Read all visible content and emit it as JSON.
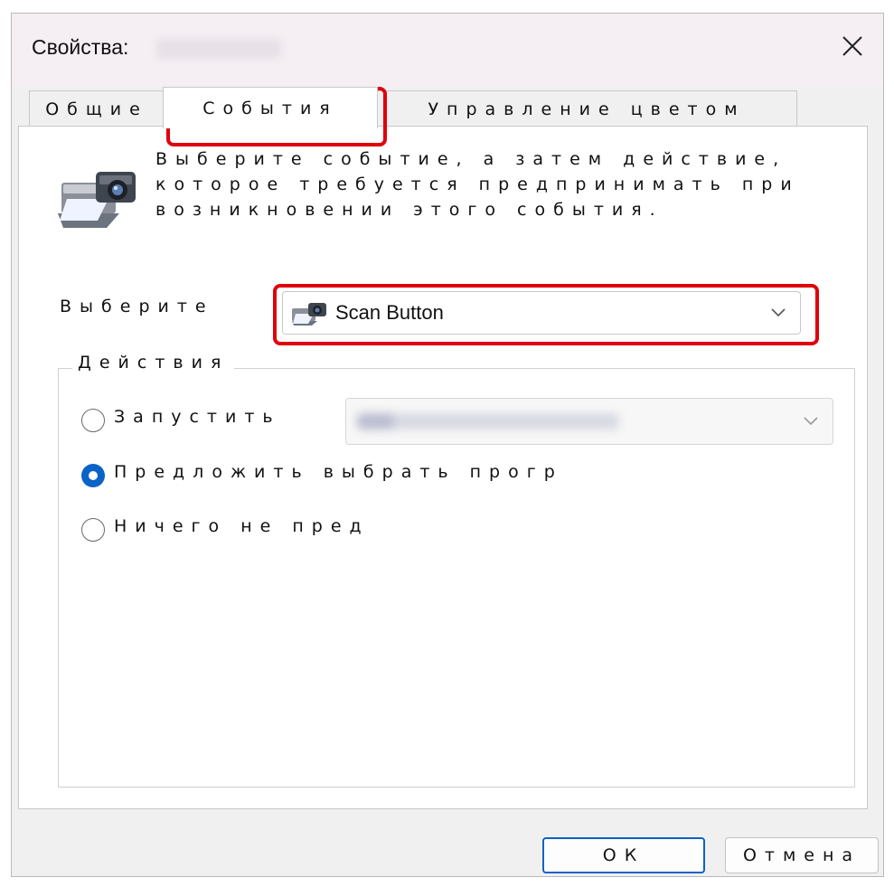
{
  "window": {
    "title": "Свойства:",
    "close_glyph": "✕"
  },
  "tabs": [
    {
      "label": "Общие",
      "active": false
    },
    {
      "label": "События",
      "active": true
    },
    {
      "label": "Управление цветом",
      "active": false
    }
  ],
  "events": {
    "description": "Выберите событие, а затем действие, которое требуется предпринимать при возникновении этого события.",
    "select_label": "Выберите",
    "selected_event": "Scan Button",
    "device_icon": "scanner-camera-icon"
  },
  "actions": {
    "legend": "Действия",
    "options": [
      {
        "label": "Запустить",
        "checked": false
      },
      {
        "label": "Предложить выбрать прогр",
        "checked": true
      },
      {
        "label": "Ничего не пред",
        "checked": false
      }
    ],
    "program_icon": "chevron-down-icon"
  },
  "buttons": {
    "ok": "ОК",
    "cancel": "Отмена"
  },
  "colors": {
    "accent": "#0a63c7",
    "highlight": "#e0000d",
    "titlebar": "#f5eef3"
  }
}
